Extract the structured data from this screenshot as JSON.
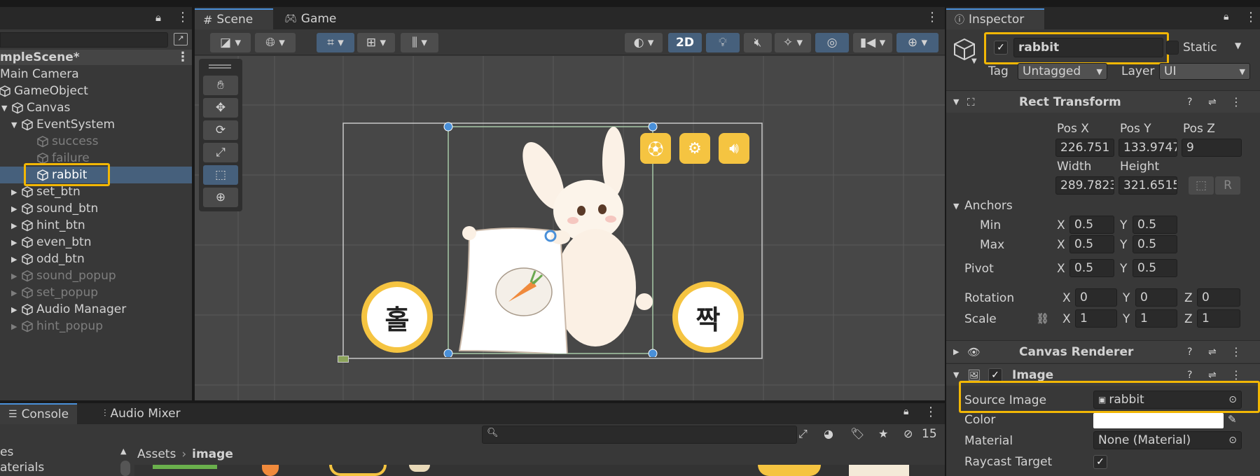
{
  "hierarchy": {
    "scene_name": "mpleScene*",
    "items": [
      {
        "label": "Main Camera"
      },
      {
        "label": "GameObject"
      },
      {
        "label": "Canvas"
      },
      {
        "label": "EventSystem"
      },
      {
        "label": "success"
      },
      {
        "label": "failure"
      },
      {
        "label": "rabbit"
      },
      {
        "label": "set_btn"
      },
      {
        "label": "sound_btn"
      },
      {
        "label": "hint_btn"
      },
      {
        "label": "even_btn"
      },
      {
        "label": "odd_btn"
      },
      {
        "label": "sound_popup"
      },
      {
        "label": "set_popup"
      },
      {
        "label": "Audio Manager"
      },
      {
        "label": "hint_popup"
      }
    ]
  },
  "scene_view": {
    "tabs": [
      {
        "label": "Scene"
      },
      {
        "label": "Game"
      }
    ],
    "mode_2d": "2D",
    "left_button_text": "홀",
    "right_button_text": "짝"
  },
  "bottom": {
    "tabs": [
      {
        "label": "Console"
      },
      {
        "label": "Audio Mixer"
      }
    ],
    "hidden_count": "15",
    "breadcrumb_root": "Assets",
    "breadcrumb_leaf": "image",
    "tree_items": [
      {
        "label": "es"
      },
      {
        "label": "aterials"
      }
    ]
  },
  "inspector": {
    "tab_label": "Inspector",
    "object_name": "rabbit",
    "static_label": "Static",
    "tag_label": "Tag",
    "tag_value": "Untagged",
    "layer_label": "Layer",
    "layer_value": "UI",
    "rect_transform": {
      "title": "Rect Transform",
      "pos_x_label": "Pos X",
      "pos_y_label": "Pos Y",
      "pos_z_label": "Pos Z",
      "pos_x": "226.751",
      "pos_y": "133.9747",
      "pos_z": "9",
      "width_label": "Width",
      "height_label": "Height",
      "width": "289.7823",
      "height": "321.6515",
      "r_label": "R",
      "anchors_label": "Anchors",
      "min_label": "Min",
      "max_label": "Max",
      "pivot_label": "Pivot",
      "x": "X",
      "y": "Y",
      "z": "Z",
      "min_x": "0.5",
      "min_y": "0.5",
      "max_x": "0.5",
      "max_y": "0.5",
      "pivot_x": "0.5",
      "pivot_y": "0.5",
      "rotation_label": "Rotation",
      "rot_x": "0",
      "rot_y": "0",
      "rot_z": "0",
      "scale_label": "Scale",
      "scale_x": "1",
      "scale_y": "1",
      "scale_z": "1"
    },
    "canvas_renderer": {
      "title": "Canvas Renderer"
    },
    "image": {
      "title": "Image",
      "source_image_label": "Source Image",
      "source_image_value": "rabbit",
      "color_label": "Color",
      "material_label": "Material",
      "material_value": "None (Material)",
      "raycast_label": "Raycast Target"
    }
  },
  "colors": {
    "highlight": "#f2b705",
    "accent_blue": "#4a90d9",
    "toggle_active": "#46607c"
  }
}
